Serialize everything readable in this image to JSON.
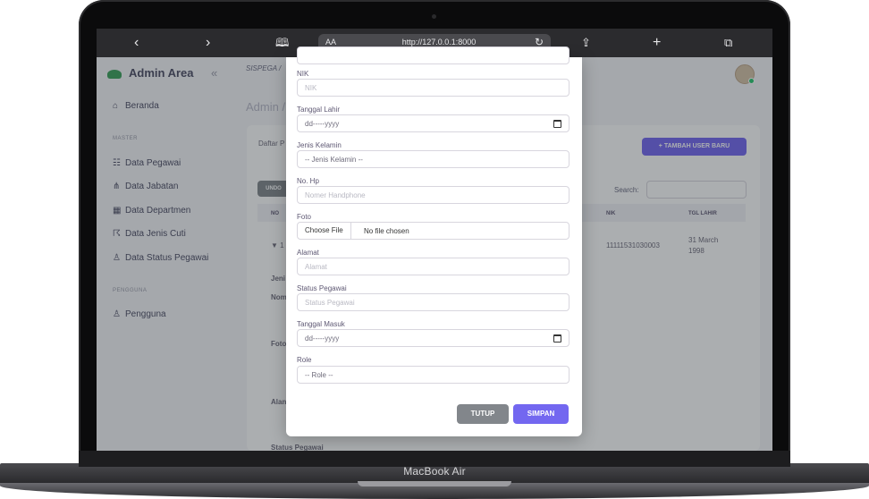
{
  "browser": {
    "back_icon": "chevron-left",
    "forward_icon": "chevron-right",
    "reader_label": "AA",
    "url": "http://127.0.0.1:8000",
    "reload_icon": "reload",
    "share_icon": "share",
    "new_tab_icon": "plus",
    "tabs_icon": "tabs"
  },
  "device_label": "MacBook Air",
  "sidebar": {
    "brand": "Admin Area",
    "collapse": "«",
    "home": "Beranda",
    "master_section": "MASTER",
    "master_items": [
      {
        "label": "Data Pegawai",
        "icon": "users-icon"
      },
      {
        "label": "Data Jabatan",
        "icon": "hierarchy-icon"
      },
      {
        "label": "Data Departmen",
        "icon": "building-icon"
      },
      {
        "label": "Data Jenis Cuti",
        "icon": "running-icon"
      },
      {
        "label": "Data Status Pegawai",
        "icon": "user-status-icon"
      }
    ],
    "user_section": "PENGGUNA",
    "user_items": [
      {
        "label": "Pengguna",
        "icon": "user-icon"
      }
    ]
  },
  "main": {
    "breadcrumb": "SISPEGA /",
    "page_title": "Admin /",
    "card_title": "Daftar P",
    "add_button": "+ TAMBAH USER BARU",
    "undo_button": "UNDO",
    "search_label": "Search:",
    "columns": [
      "NO",
      "NIK",
      "TGL LAHIR"
    ],
    "row": {
      "no": "▼ 1",
      "nik": "11111531030003",
      "tgl_lahir": "31 March 1998"
    },
    "detail_labels": [
      "Jeni",
      "Nom",
      "Foto",
      "Alan",
      "Status Pegawai"
    ]
  },
  "modal": {
    "fields": [
      {
        "label": "NIK",
        "placeholder": "NIK",
        "type": "text"
      },
      {
        "label": "Tanggal Lahir",
        "value": "dd-----yyyy",
        "type": "date"
      },
      {
        "label": "Jenis Kelamin",
        "value": "-- Jenis Kelamin --",
        "type": "select"
      },
      {
        "label": "No. Hp",
        "placeholder": "Nomer Handphone",
        "type": "text"
      },
      {
        "label": "Foto",
        "button": "Choose File",
        "value": "No file chosen",
        "type": "file"
      },
      {
        "label": "Alamat",
        "placeholder": "Alamat",
        "type": "text"
      },
      {
        "label": "Status Pegawai",
        "placeholder": "Status Pegawai",
        "type": "text"
      },
      {
        "label": "Tanggal Masuk",
        "value": "dd-----yyyy",
        "type": "date"
      },
      {
        "label": "Role",
        "value": "-- Role --",
        "type": "select"
      }
    ],
    "close_button": "TUTUP",
    "save_button": "SIMPAN"
  },
  "colors": {
    "primary": "#7367f0",
    "secondary": "#82868b",
    "brand_green": "#3aa15a"
  }
}
